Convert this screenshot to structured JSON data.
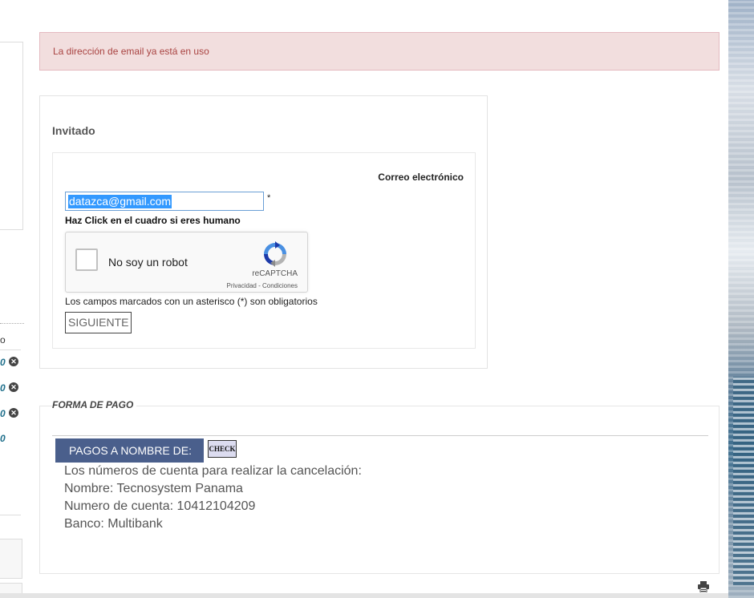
{
  "alert": {
    "message": "La dirección de email ya está en uso"
  },
  "guest_form": {
    "title": "Invitado",
    "email_label": "Correo electrónico",
    "email_value": "datazca@gmail.com",
    "required_marker": "*",
    "human_prompt": "Haz Click en el cuadro si eres humano",
    "recaptcha": {
      "label": "No soy un robot",
      "brand": "reCAPTCHA",
      "links": "Privacidad - Condiciones"
    },
    "required_note": "Los campos marcados con un asterisco (*) son obligatorios",
    "next_button": "SIGUIENTE"
  },
  "payment": {
    "legend": "FORMA DE PAGO",
    "pay_to_label": "PAGOS A NOMBRE DE:",
    "check_button": "CHECK",
    "lines": [
      "Los números de cuenta para realizar la cancelación:",
      "Nombre: Tecnosystem Panama",
      "Numero de cuenta: 10412104209",
      "Banco: Multibank"
    ]
  },
  "left_sidebar": {
    "stub_text": "o",
    "row_values": [
      "0",
      "0",
      "0",
      "0"
    ]
  }
}
